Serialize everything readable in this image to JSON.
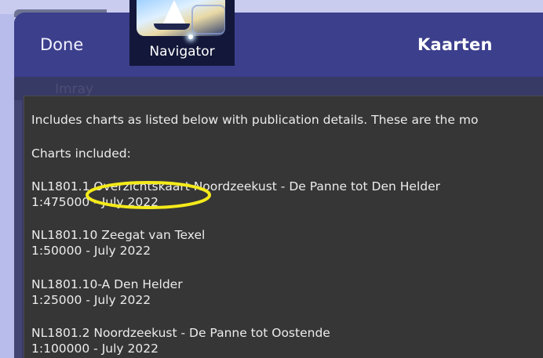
{
  "app_icon": {
    "label": "Navigator"
  },
  "navbar": {
    "done_label": "Done",
    "title": "Kaarten"
  },
  "background_hint": "Imray",
  "content": {
    "intro": "Includes charts as listed below with publication details. These are the mo",
    "charts_heading": "Charts included:",
    "charts": [
      {
        "name": "NL1801.1 Overzichtskaart Noordzeekust - De Panne tot Den Helder",
        "detail": "1:475000 - July 2022"
      },
      {
        "name": "NL1801.10 Zeegat van Texel",
        "detail": "1:50000 - July 2022"
      },
      {
        "name": "NL1801.10-A Den Helder",
        "detail": "1:25000 - July 2022"
      },
      {
        "name": "NL1801.2 Noordzeekust - De Panne tot Oostende",
        "detail": "1:100000 - July 2022"
      }
    ]
  },
  "colors": {
    "navbar": "#3c3f8c",
    "content_bg": "#363636",
    "highlight": "#f4ea1a"
  },
  "icons": [
    "sailboat-app-icon",
    "highlight-ellipse"
  ]
}
